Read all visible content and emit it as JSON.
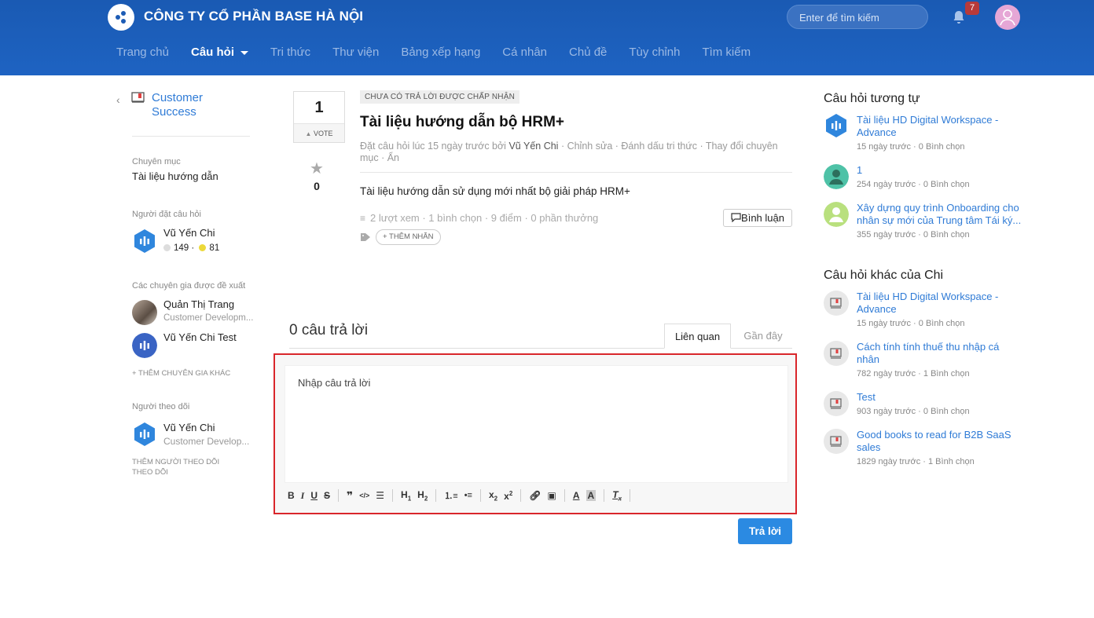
{
  "header": {
    "company": "CÔNG TY CỔ PHẦN BASE HÀ NỘI",
    "search_placeholder": "Enter để tìm kiếm",
    "notification_count": "7",
    "nav": [
      {
        "label": "Trang chủ",
        "active": false
      },
      {
        "label": "Câu hỏi",
        "active": true
      },
      {
        "label": "Tri thức",
        "active": false
      },
      {
        "label": "Thư viện",
        "active": false
      },
      {
        "label": "Bảng xếp hạng",
        "active": false
      },
      {
        "label": "Cá nhân",
        "active": false
      },
      {
        "label": "Chủ đề",
        "active": false
      },
      {
        "label": "Tùy chỉnh",
        "active": false
      },
      {
        "label": "Tìm kiếm",
        "active": false
      }
    ]
  },
  "left": {
    "space_name": "Customer Success",
    "category_label": "Chuyên mục",
    "category_value": "Tài liệu hướng dẫn",
    "asker_label": "Người đặt câu hỏi",
    "asker_name": "Vũ Yến Chi",
    "asker_points_gray": "149",
    "asker_points_yellow": "81",
    "experts_label": "Các chuyên gia được đề xuất",
    "experts": [
      {
        "name": "Quản Thị Trang",
        "sub": "Customer Developm..."
      },
      {
        "name": "Vũ Yến Chi Test",
        "sub": ""
      }
    ],
    "add_expert": "+ THÊM CHUYÊN GIA KHÁC",
    "followers_label": "Người theo dõi",
    "follower_name": "Vũ Yến Chi",
    "follower_sub": "Customer Develop...",
    "add_follower": "THÊM NGƯỜI THEO DÕI THEO DÕI"
  },
  "question": {
    "votes": "1",
    "vote_label": "VOTE",
    "stars": "0",
    "status": "CHƯA CÓ TRẢ LỜI ĐƯỢC CHẤP NHẬN",
    "title": "Tài liệu hướng dẫn bộ HRM+",
    "meta_prefix": "Đặt câu hỏi lúc 15 ngày trước bởi",
    "meta_user": "Vũ Yến Chi",
    "meta_actions": " · Chỉnh sửa · Đánh dấu tri thức · Thay đổi chuyên mục · Ẩn",
    "body": "Tài liệu hướng dẫn sử dụng mới nhất bộ giải pháp HRM+",
    "stats": "2 lượt xem · 1 bình chọn · 9 điểm · 0 phần thưởng",
    "comment_button": "Bình luận",
    "add_tag": "+ THÊM NHÃN"
  },
  "answers": {
    "count": "0 câu trả lời",
    "tab_related": "Liên quan",
    "tab_recent": "Gần đây",
    "editor_placeholder": "Nhập câu trả lời",
    "reply_button": "Trả lời"
  },
  "right": {
    "similar_title": "Câu hỏi tương tự",
    "similar": [
      {
        "title": "Tài liệu HD Digital Workspace - Advance",
        "meta": "15 ngày trước · 0 Bình chọn"
      },
      {
        "title": "1",
        "meta": "254 ngày trước · 0 Bình chọn"
      },
      {
        "title": "Xây dựng quy trình Onboarding cho nhân sự mới của Trung tâm Tái ký...",
        "meta": "355 ngày trước · 0 Bình chọn"
      }
    ],
    "other_title": "Câu hỏi khác của Chi",
    "other": [
      {
        "title": "Tài liệu HD Digital Workspace - Advance",
        "meta": "15 ngày trước · 0 Bình chọn"
      },
      {
        "title": "Cách tính tính thuế thu nhập cá nhân",
        "meta": "782 ngày trước · 1 Bình chọn"
      },
      {
        "title": "Test",
        "meta": "903 ngày trước · 0 Bình chọn"
      },
      {
        "title": "Good books to read for B2B SaaS sales",
        "meta": "1829 ngày trước · 1 Bình chọn"
      }
    ]
  },
  "colors": {
    "header_bg": "#1d5cb5",
    "link": "#2f7bd6",
    "primary_button": "#2b8ae2",
    "highlight_border": "#d9262b"
  }
}
